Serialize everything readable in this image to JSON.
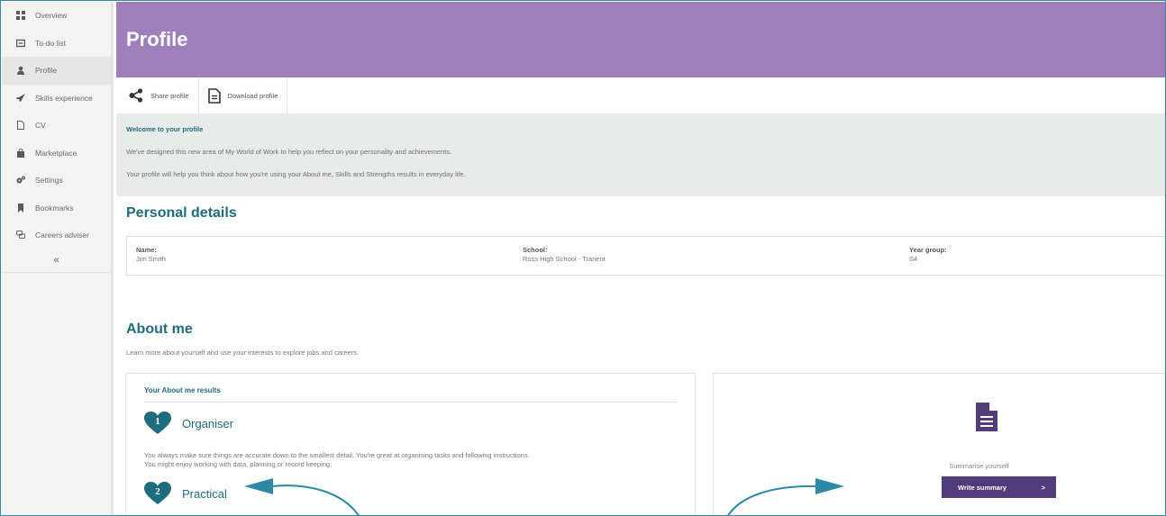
{
  "sidebar": {
    "items": [
      {
        "label": "Overview",
        "icon": "grid-icon"
      },
      {
        "label": "To-do list",
        "icon": "list-icon"
      },
      {
        "label": "Profile",
        "icon": "person-icon"
      },
      {
        "label": "Skills experience",
        "icon": "rocket-icon"
      },
      {
        "label": "CV",
        "icon": "document-icon"
      },
      {
        "label": "Marketplace",
        "icon": "bag-icon"
      },
      {
        "label": "Settings",
        "icon": "gears-icon"
      },
      {
        "label": "Bookmarks",
        "icon": "bookmark-icon"
      },
      {
        "label": "Careers adviser",
        "icon": "chat-icon"
      }
    ],
    "active": "Profile",
    "collapse_label": "«"
  },
  "header": {
    "title": "Profile"
  },
  "toolbar": {
    "share_label": "Share profile",
    "download_label": "Download profile"
  },
  "welcome": {
    "title": "Welcome to your profile",
    "line1": "We've designed this new area of My World of Work to help you reflect on your personality and achievements.",
    "line2": "Your profile will help you think about how you're using your About me, Skills and Strengths results in everyday life."
  },
  "personal_details": {
    "title": "Personal details",
    "name_label": "Name:",
    "name_value": "Jim Smith",
    "school_label": "School:",
    "school_value": "Ross High School - Tranent",
    "year_label": "Year group:",
    "year_value": "S4"
  },
  "about_me": {
    "title": "About me",
    "subtitle": "Learn more about yourself and use your interests to explore jobs and careers.",
    "results_title": "Your About me results",
    "results": [
      {
        "rank": "1",
        "name": "Organiser",
        "description_line1": "You always make sure things are accurate down to the smallest detail. You're great at organising tasks and following instructions.",
        "description_line2": "You might enjoy working with data, planning or record keeping."
      },
      {
        "rank": "2",
        "name": "Practical"
      }
    ],
    "summary_label": "Summarise yourself",
    "summary_button": "Write summary",
    "summary_button_arrow": ">"
  },
  "colors": {
    "header": "#9e7fbb",
    "teal": "#1f6c7c",
    "button": "#513c7b",
    "annotation": "#2d8aa6"
  }
}
